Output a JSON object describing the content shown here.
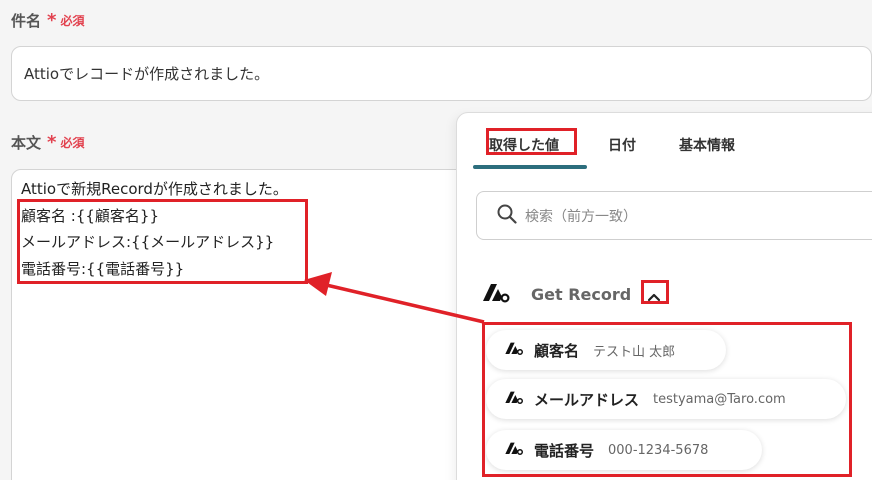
{
  "subject": {
    "label": "件名",
    "required_mark": "*",
    "required_text": "必須",
    "value": "Attioでレコードが作成されました。"
  },
  "body": {
    "label": "本文",
    "required_mark": "*",
    "required_text": "必須",
    "lines": [
      "Attioで新規Recordが作成されました。",
      "顧客名 :{{顧客名}}",
      "メールアドレス:{{メールアドレス}}",
      "電話番号:{{電話番号}}"
    ]
  },
  "panel": {
    "tabs": [
      "取得した値",
      "日付",
      "基本情報"
    ],
    "active_tab": "取得した値",
    "search": {
      "placeholder": "検索（前方一致）",
      "icon": "search-icon"
    },
    "group": {
      "title": "Get Record",
      "icon": "attio-logo-icon",
      "toggle_icon": "chevron-up-icon",
      "items": [
        {
          "key": "顧客名",
          "value": "テスト山 太郎"
        },
        {
          "key": "メールアドレス",
          "value": "testyama@Taro.com"
        },
        {
          "key": "電話番号",
          "value": "000-1234-5678"
        }
      ]
    }
  },
  "colors": {
    "accent": "#2c6e7d",
    "required": "#e2424f",
    "annotation": "#e02128"
  }
}
